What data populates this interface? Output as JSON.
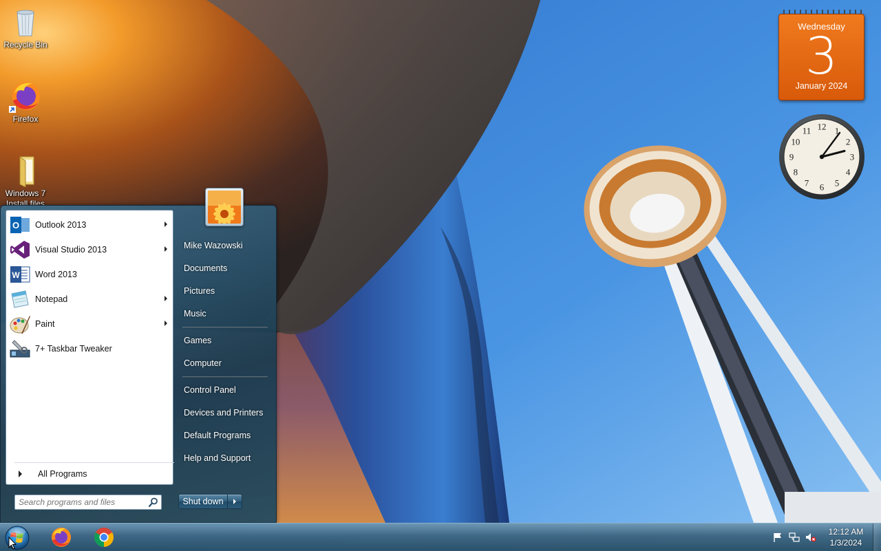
{
  "desktop": {
    "icons": [
      {
        "label": "Recycle Bin",
        "icon": "recycle-bin-icon"
      },
      {
        "label": "Firefox",
        "icon": "firefox-icon"
      },
      {
        "label": "Windows 7 Install files",
        "icon": "folder-icon"
      }
    ]
  },
  "gadgets": {
    "calendar": {
      "weekday": "Wednesday",
      "day": "3",
      "month_year": "January 2024"
    },
    "clock": {
      "numerals": [
        "12",
        "1",
        "2",
        "3",
        "4",
        "5",
        "6",
        "7",
        "8",
        "9",
        "10",
        "11"
      ],
      "time": "12:12"
    }
  },
  "start_menu": {
    "programs": [
      {
        "label": "Outlook 2013",
        "icon": "outlook-icon",
        "has_submenu": true
      },
      {
        "label": "Visual Studio 2013",
        "icon": "visual-studio-icon",
        "has_submenu": true
      },
      {
        "label": "Word 2013",
        "icon": "word-icon",
        "has_submenu": false
      },
      {
        "label": "Notepad",
        "icon": "notepad-icon",
        "has_submenu": true
      },
      {
        "label": "Paint",
        "icon": "paint-icon",
        "has_submenu": true
      },
      {
        "label": "7+ Taskbar Tweaker",
        "icon": "taskbar-tweaker-icon",
        "has_submenu": false
      }
    ],
    "all_programs_label": "All Programs",
    "search_placeholder": "Search programs and files",
    "right_items": {
      "user": "Mike Wazowski",
      "documents": "Documents",
      "pictures": "Pictures",
      "music": "Music",
      "games": "Games",
      "computer": "Computer",
      "control_panel": "Control Panel",
      "devices_printers": "Devices and Printers",
      "default_programs": "Default Programs",
      "help_support": "Help and Support"
    },
    "shutdown_label": "Shut down"
  },
  "taskbar": {
    "pinned": [
      "Firefox",
      "Chrome"
    ],
    "tray_icons": [
      "action-center-flag-icon",
      "network-icon",
      "volume-muted-icon"
    ],
    "time": "12:12 AM",
    "date": "1/3/2024"
  },
  "colors": {
    "calendar_orange": "#e8681a",
    "taskbar": "#3c6480",
    "start_menu_glass": "#2c5670"
  }
}
